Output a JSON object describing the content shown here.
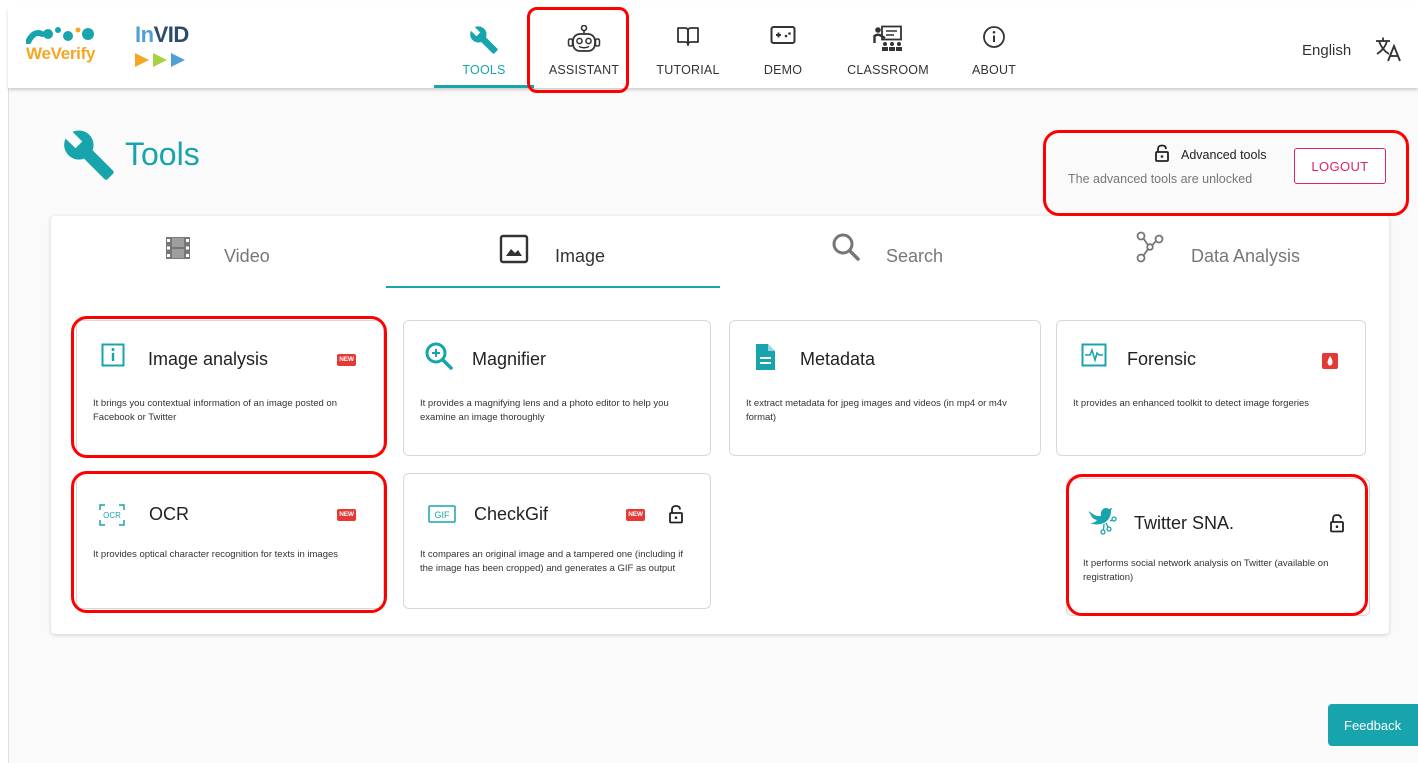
{
  "brand": {
    "weverify_logo": "WeVerify",
    "invid_logo_prefix": "In",
    "invid_logo_suffix": "VID"
  },
  "nav": {
    "items": [
      {
        "label": "TOOLS",
        "icon": "wrench-icon",
        "active": true
      },
      {
        "label": "ASSISTANT",
        "icon": "robot-icon"
      },
      {
        "label": "TUTORIAL",
        "icon": "book-icon"
      },
      {
        "label": "DEMO",
        "icon": "gamepad-icon"
      },
      {
        "label": "CLASSROOM",
        "icon": "classroom-icon"
      },
      {
        "label": "ABOUT",
        "icon": "info-icon"
      }
    ],
    "language": "English",
    "language_icon": "translate-icon"
  },
  "page": {
    "title": "Tools",
    "title_icon": "wrench-icon"
  },
  "advanced": {
    "title": "Advanced tools",
    "subtitle": "The advanced tools are unlocked",
    "logout_label": "LOGOUT"
  },
  "tabs": [
    {
      "label": "Video",
      "icon": "film-icon"
    },
    {
      "label": "Image",
      "icon": "image-icon",
      "active": true
    },
    {
      "label": "Search",
      "icon": "search-icon"
    },
    {
      "label": "Data Analysis",
      "icon": "graph-icon"
    }
  ],
  "tools": [
    {
      "name": "Image analysis",
      "desc": "It brings you contextual information of an image posted on Facebook or Twitter",
      "icon": "info-box-icon",
      "badge": "NEW"
    },
    {
      "name": "Magnifier",
      "desc": "It provides a magnifying lens and a photo editor to help you examine an image thoroughly",
      "icon": "magnifier-icon"
    },
    {
      "name": "Metadata",
      "desc": "It extract metadata for jpeg images and videos (in mp4 or m4v format)",
      "icon": "document-icon"
    },
    {
      "name": "Forensic",
      "desc": "It provides an enhanced toolkit to detect image forgeries",
      "icon": "waveform-icon",
      "badge_icon": "fire-badge-icon"
    },
    {
      "name": "OCR",
      "desc": "It provides optical character recognition for texts in images",
      "icon": "ocr-icon",
      "icon_text": "OCR",
      "badge": "NEW"
    },
    {
      "name": "CheckGif",
      "desc": "It compares an original image and a tampered one (including if the image has been cropped) and generates a GIF as output",
      "icon": "gif-icon",
      "icon_text": "GIF",
      "badge": "NEW",
      "locked": true
    },
    {
      "name": "Twitter SNA.",
      "desc": "It performs social network analysis on Twitter (available on registration)",
      "icon": "twitter-graph-icon",
      "locked": true
    }
  ],
  "feedback_label": "Feedback",
  "colors": {
    "accent": "#18a4ad",
    "logout": "#e0245e",
    "new_badge": "#e53935",
    "highlight": "#ff0000"
  }
}
